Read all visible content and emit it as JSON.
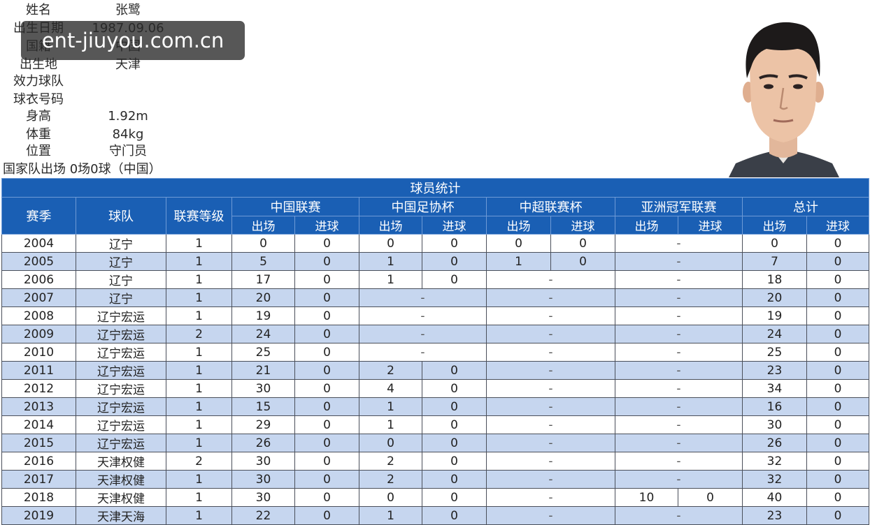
{
  "watermark": "ent-jiuyou.com.cn",
  "profile": {
    "rows": [
      {
        "label": "姓名",
        "value": "张鹭"
      },
      {
        "label": "出生日期",
        "value": "1987.09.06"
      },
      {
        "label": "国籍",
        "value": "中国"
      },
      {
        "label": "出生地",
        "value": "天津"
      },
      {
        "label": "效力球队",
        "value": ""
      },
      {
        "label": "球衣号码",
        "value": ""
      },
      {
        "label": "身高",
        "value": "1.92m"
      },
      {
        "label": "体重",
        "value": "84kg"
      },
      {
        "label": "位置",
        "value": "守门员"
      }
    ],
    "national_team": "国家队出场  0场0球（中国）"
  },
  "photo_icon": "player-portrait",
  "colors": {
    "header_blue": "#1a5fb4",
    "row_alt": "#c6d6ef"
  },
  "table": {
    "title": "球员统计",
    "col_season": "赛季",
    "col_team": "球队",
    "col_level": "联赛等级",
    "groups": [
      "中国联赛",
      "中国足协杯",
      "中超联赛杯",
      "亚洲冠军联赛",
      "总计"
    ],
    "apps_label": "出场",
    "goals_label": "进球",
    "dash": "-",
    "rows": [
      {
        "season": "2004",
        "team": "辽宁",
        "level": "1",
        "league": [
          "0",
          "0"
        ],
        "fa": [
          "0",
          "0"
        ],
        "csl_cup": [
          "0",
          "0"
        ],
        "acl": null,
        "total": [
          "0",
          "0"
        ]
      },
      {
        "season": "2005",
        "team": "辽宁",
        "level": "1",
        "league": [
          "5",
          "0"
        ],
        "fa": [
          "1",
          "0"
        ],
        "csl_cup": [
          "1",
          "0"
        ],
        "acl": null,
        "total": [
          "7",
          "0"
        ]
      },
      {
        "season": "2006",
        "team": "辽宁",
        "level": "1",
        "league": [
          "17",
          "0"
        ],
        "fa": [
          "1",
          "0"
        ],
        "csl_cup": null,
        "acl": null,
        "total": [
          "18",
          "0"
        ]
      },
      {
        "season": "2007",
        "team": "辽宁",
        "level": "1",
        "league": [
          "20",
          "0"
        ],
        "fa": null,
        "csl_cup": null,
        "acl": null,
        "total": [
          "20",
          "0"
        ]
      },
      {
        "season": "2008",
        "team": "辽宁宏运",
        "level": "1",
        "league": [
          "19",
          "0"
        ],
        "fa": null,
        "csl_cup": null,
        "acl": null,
        "total": [
          "19",
          "0"
        ]
      },
      {
        "season": "2009",
        "team": "辽宁宏运",
        "level": "2",
        "league": [
          "24",
          "0"
        ],
        "fa": null,
        "csl_cup": null,
        "acl": null,
        "total": [
          "24",
          "0"
        ]
      },
      {
        "season": "2010",
        "team": "辽宁宏运",
        "level": "1",
        "league": [
          "25",
          "0"
        ],
        "fa": null,
        "csl_cup": null,
        "acl": null,
        "total": [
          "25",
          "0"
        ]
      },
      {
        "season": "2011",
        "team": "辽宁宏运",
        "level": "1",
        "league": [
          "21",
          "0"
        ],
        "fa": [
          "2",
          "0"
        ],
        "csl_cup": null,
        "acl": null,
        "total": [
          "23",
          "0"
        ]
      },
      {
        "season": "2012",
        "team": "辽宁宏运",
        "level": "1",
        "league": [
          "30",
          "0"
        ],
        "fa": [
          "4",
          "0"
        ],
        "csl_cup": null,
        "acl": null,
        "total": [
          "34",
          "0"
        ]
      },
      {
        "season": "2013",
        "team": "辽宁宏运",
        "level": "1",
        "league": [
          "15",
          "0"
        ],
        "fa": [
          "1",
          "0"
        ],
        "csl_cup": null,
        "acl": null,
        "total": [
          "16",
          "0"
        ]
      },
      {
        "season": "2014",
        "team": "辽宁宏运",
        "level": "1",
        "league": [
          "29",
          "0"
        ],
        "fa": [
          "1",
          "0"
        ],
        "csl_cup": null,
        "acl": null,
        "total": [
          "30",
          "0"
        ]
      },
      {
        "season": "2015",
        "team": "辽宁宏运",
        "level": "1",
        "league": [
          "26",
          "0"
        ],
        "fa": [
          "0",
          "0"
        ],
        "csl_cup": null,
        "acl": null,
        "total": [
          "26",
          "0"
        ]
      },
      {
        "season": "2016",
        "team": "天津权健",
        "level": "2",
        "league": [
          "30",
          "0"
        ],
        "fa": [
          "2",
          "0"
        ],
        "csl_cup": null,
        "acl": null,
        "total": [
          "32",
          "0"
        ]
      },
      {
        "season": "2017",
        "team": "天津权健",
        "level": "1",
        "league": [
          "30",
          "0"
        ],
        "fa": [
          "2",
          "0"
        ],
        "csl_cup": null,
        "acl": null,
        "total": [
          "32",
          "0"
        ]
      },
      {
        "season": "2018",
        "team": "天津权健",
        "level": "1",
        "league": [
          "30",
          "0"
        ],
        "fa": [
          "0",
          "0"
        ],
        "csl_cup": null,
        "acl": [
          "10",
          "0"
        ],
        "total": [
          "40",
          "0"
        ]
      },
      {
        "season": "2019",
        "team": "天津天海",
        "level": "1",
        "league": [
          "22",
          "0"
        ],
        "fa": [
          "1",
          "0"
        ],
        "csl_cup": null,
        "acl": null,
        "total": [
          "23",
          "0"
        ]
      }
    ]
  }
}
